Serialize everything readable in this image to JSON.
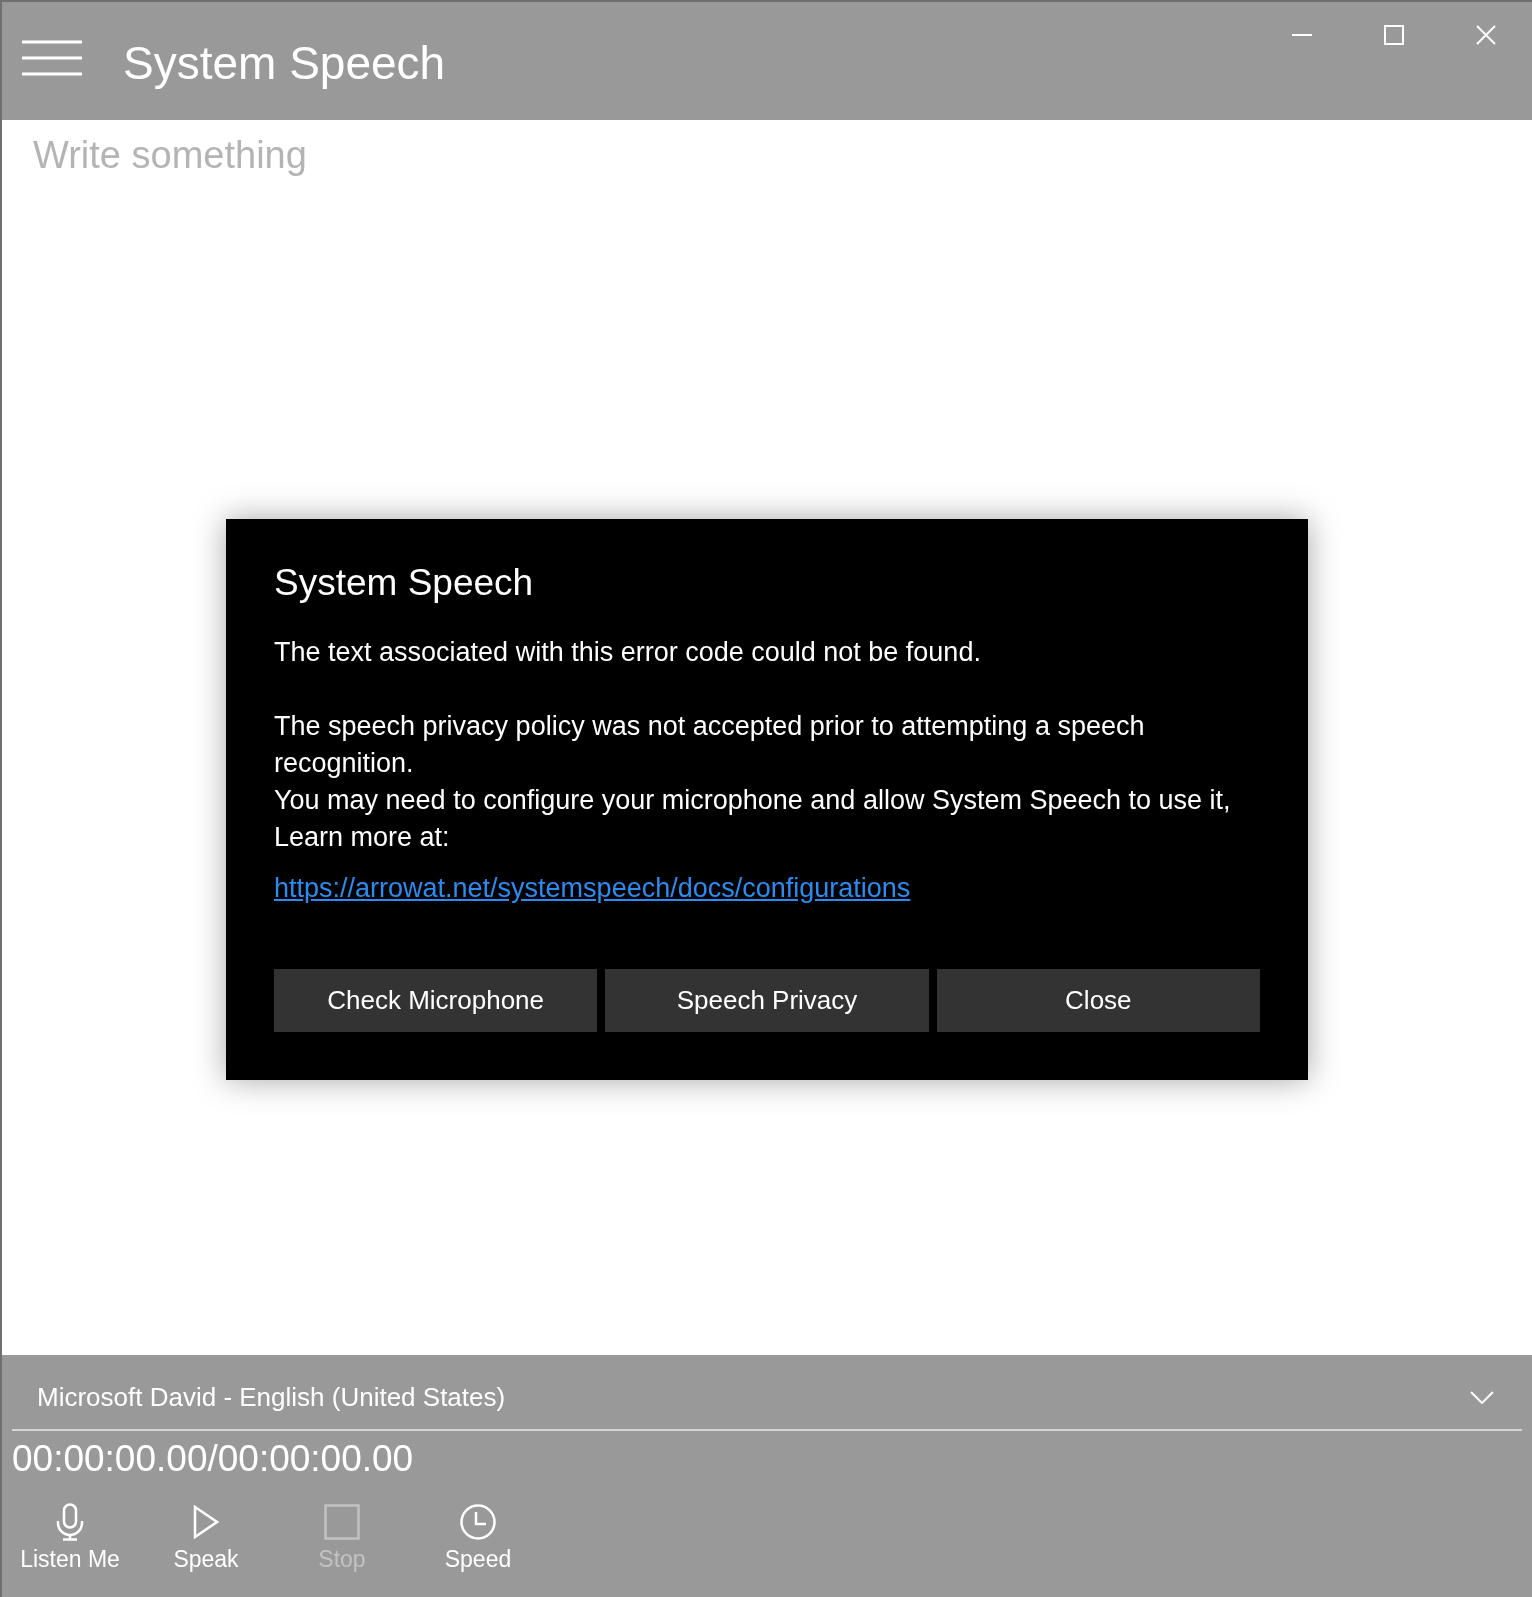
{
  "window": {
    "title": "System Speech"
  },
  "editor": {
    "placeholder": "Write something"
  },
  "dialog": {
    "title": "System Speech",
    "message": "The text associated with this error code could not be found.",
    "details": [
      "The speech privacy policy was not accepted prior to attempting a speech recognition.",
      "You may need to configure your microphone and allow System Speech to use it, Learn more at:"
    ],
    "link": "https://arrowat.net/systemspeech/docs/configurations",
    "buttons": [
      "Check Microphone",
      "Speech Privacy",
      "Close"
    ]
  },
  "voice_select": {
    "value": "Microsoft David - English (United States)"
  },
  "timer": "00:00:00.00/00:00:00.00",
  "toolbar": [
    {
      "kind": "microphone",
      "label": "Listen Me",
      "disabled": false
    },
    {
      "kind": "play",
      "label": "Speak",
      "disabled": false
    },
    {
      "kind": "stop",
      "label": "Stop",
      "disabled": true
    },
    {
      "kind": "clock",
      "label": "Speed",
      "disabled": false
    }
  ]
}
